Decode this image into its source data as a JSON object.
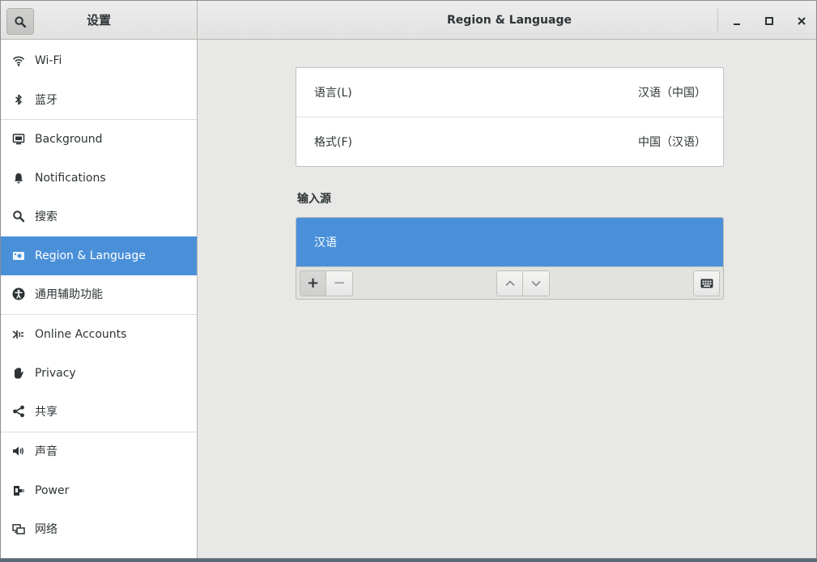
{
  "header": {
    "sidebar_title": "设置",
    "window_title": "Region & Language",
    "search_icon": "search-icon",
    "minimize_icon": "minimize-icon",
    "maximize_icon": "maximize-icon",
    "close_icon": "close-icon"
  },
  "sidebar": {
    "items": [
      {
        "label": "Wi-Fi",
        "icon": "wifi-icon"
      },
      {
        "label": "蓝牙",
        "icon": "bluetooth-icon"
      },
      {
        "label": "Background",
        "icon": "background-icon"
      },
      {
        "label": "Notifications",
        "icon": "bell-icon"
      },
      {
        "label": "搜索",
        "icon": "search-icon"
      },
      {
        "label": "Region & Language",
        "icon": "region-flag-icon",
        "selected": true
      },
      {
        "label": "通用辅助功能",
        "icon": "accessibility-icon"
      },
      {
        "label": "Online Accounts",
        "icon": "online-accounts-icon"
      },
      {
        "label": "Privacy",
        "icon": "hand-icon"
      },
      {
        "label": "共享",
        "icon": "share-icon"
      },
      {
        "label": "声音",
        "icon": "speaker-icon"
      },
      {
        "label": "Power",
        "icon": "power-plug-icon"
      },
      {
        "label": "网络",
        "icon": "network-icon"
      }
    ]
  },
  "main": {
    "language": {
      "label": "语言(L)",
      "value": "汉语（中国）"
    },
    "formats": {
      "label": "格式(F)",
      "value": "中国（汉语）"
    },
    "input_sources_title": "输入源",
    "input_sources": [
      {
        "label": "汉语",
        "selected": true
      }
    ],
    "toolbar": {
      "add_label": "+",
      "remove_label": "−",
      "up_icon": "chevron-up-icon",
      "down_icon": "chevron-down-icon",
      "keyboard_icon": "keyboard-icon"
    }
  },
  "colors": {
    "accent": "#4a90d9",
    "window_bg": "#e8e8e7",
    "sidebar_bg": "#ffffff"
  }
}
